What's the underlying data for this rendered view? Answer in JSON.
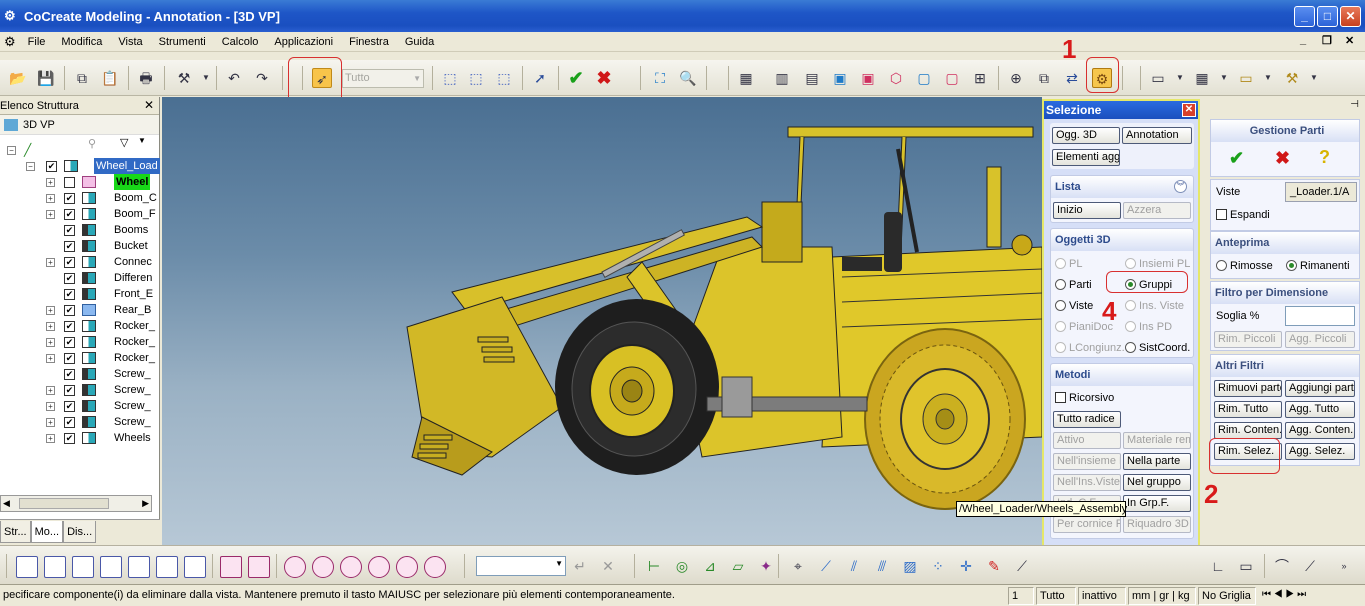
{
  "window": {
    "title": "CoCreate Modeling - Annotation - [3D VP]",
    "buttons": {
      "minimize": "_",
      "maximize": "□",
      "close": "✕"
    }
  },
  "menu": [
    "File",
    "Modifica",
    "Vista",
    "Strumenti",
    "Calcolo",
    "Applicazioni",
    "Finestra",
    "Guida"
  ],
  "toolbar": {
    "filter_select": "Tutto"
  },
  "annotations": {
    "n1": "1",
    "n2": "2",
    "n3": "3",
    "n4": "4"
  },
  "structure": {
    "title": "Elenco Struttura",
    "close": "✕",
    "viewport_label": "3D VP",
    "items": [
      "Wheel_Load",
      "Wheel",
      "Boom_C",
      "Boom_F",
      "Booms",
      "Bucket",
      "Connec",
      "Differen",
      "Front_E",
      "Rear_B",
      "Rocker_",
      "Rocker_",
      "Rocker_",
      "Screw_",
      "Screw_",
      "Screw_",
      "Screw_",
      "Wheels"
    ],
    "tabs": [
      "Str...",
      "Mo...",
      "Dis..."
    ]
  },
  "selezione": {
    "title": "Selezione",
    "top_buttons": [
      "Ogg. 3D",
      "Annotation",
      "Elementi aggi"
    ],
    "lista": {
      "title": "Lista",
      "buttons": [
        "Inizio",
        "Azzera"
      ]
    },
    "oggetti": {
      "title": "Oggetti 3D",
      "options": [
        "PL",
        "Insiemi PL",
        "Parti",
        "Gruppi",
        "Viste",
        "Ins. Viste",
        "PianiDoc",
        "Ins PD",
        "LCongiunz.",
        "SistCoord."
      ]
    },
    "metodi": {
      "title": "Metodi",
      "ricorsivo": "Ricorsivo",
      "buttons": [
        "Tutto radice",
        "Attivo",
        "Materiale rem",
        "Nell'insieme P",
        "Nella parte",
        "Nell'Ins.Viste",
        "Nel gruppo",
        "Ind. C.F.",
        "In Grp.F.",
        "Per cornice F",
        "Riquadro 3D"
      ]
    }
  },
  "tooltip": "/Wheel_Loader/Wheels_Assembly",
  "gestione": {
    "title": "Gestione Parti",
    "viste_label": "Viste",
    "viste_value": "_Loader.1/A",
    "espandi": "Espandi",
    "anteprima": {
      "title": "Anteprima",
      "options": [
        "Rimosse",
        "Rimanenti"
      ]
    },
    "filtro": {
      "title": "Filtro per Dimensione",
      "soglia": "Soglia %",
      "buttons": [
        "Rim. Piccoli",
        "Agg. Piccoli"
      ]
    },
    "altri": {
      "title": "Altri Filtri",
      "buttons": [
        "Rimuovi parte",
        "Aggiungi parte",
        "Rim. Tutto",
        "Agg. Tutto",
        "Rim. Conten.",
        "Agg. Conten.",
        "Rim. Selez.",
        "Agg. Selez."
      ]
    }
  },
  "status": {
    "message": "pecificare componente(i) da eliminare dalla vista. Mantenere premuto il tasto MAIUSC per selezionare più elementi contemporaneamente.",
    "count": "1",
    "filter": "Tutto",
    "state": "inattivo",
    "units": "mm | gr | kg",
    "grid": "No Griglia"
  }
}
